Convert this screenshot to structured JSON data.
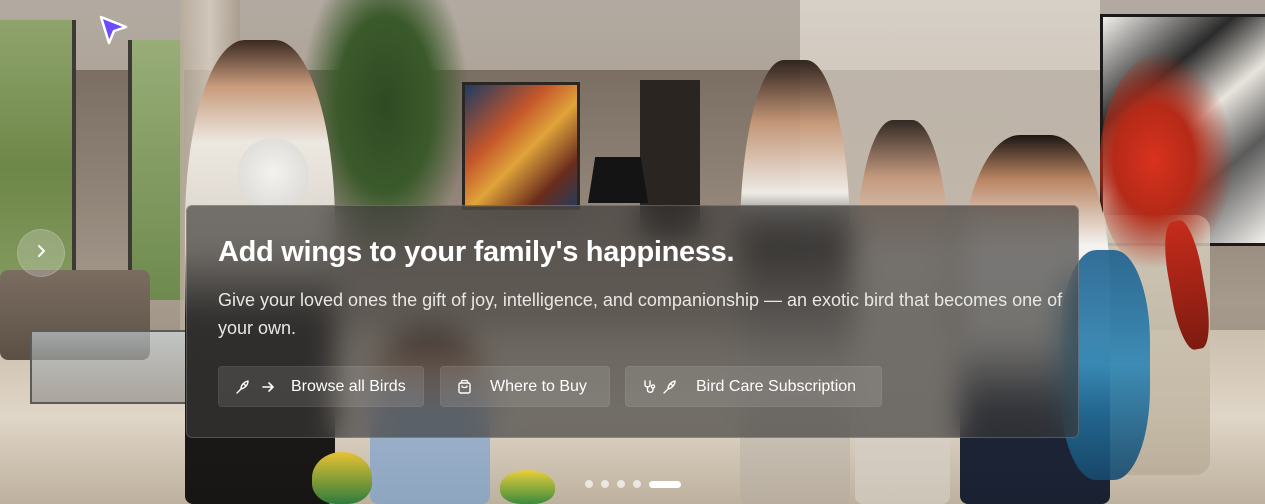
{
  "hero": {
    "title": "Add wings to your family's happiness.",
    "subtitle": "Give your loved ones the gift of joy, intelligence, and companionship — an exotic bird that becomes one of your own.",
    "buttons": [
      {
        "label": "Browse all Birds",
        "icons": [
          "bird-icon",
          "arrow-right-icon"
        ]
      },
      {
        "label": "Where to Buy",
        "icons": [
          "shopping-bag-icon"
        ]
      },
      {
        "label": "Bird Care Subscription",
        "icons": [
          "stethoscope-icon",
          "bird-icon"
        ]
      }
    ]
  },
  "carousel": {
    "slide_count": 5,
    "active_slide": 5,
    "next_icon": "chevron-right-icon"
  },
  "colors": {
    "card_bg": "#3a3836",
    "text_primary": "#ffffff",
    "cursor_accent": "#6d4cff"
  }
}
